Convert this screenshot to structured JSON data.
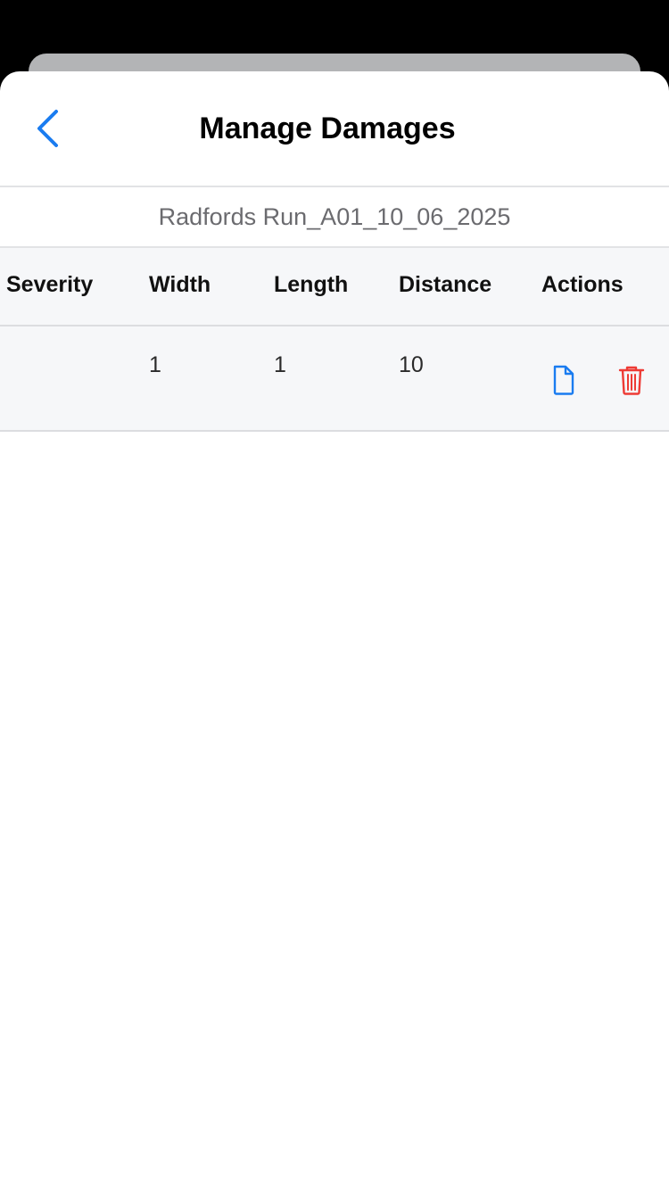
{
  "header": {
    "title": "Manage Damages",
    "back_icon": "chevron-left-icon"
  },
  "subtitle": "Radfords Run_A01_10_06_2025",
  "table": {
    "columns": [
      "Severity",
      "Width",
      "Length",
      "Distance",
      "Actions"
    ],
    "rows": [
      {
        "severity": "",
        "width": "1",
        "length": "1",
        "distance": "10",
        "actions": [
          "document-icon",
          "trash-icon"
        ]
      }
    ]
  },
  "colors": {
    "accent": "#1a7cf0",
    "danger": "#ee3b35",
    "header_bg": "#f6f7f9",
    "divider": "#e2e3e5"
  }
}
